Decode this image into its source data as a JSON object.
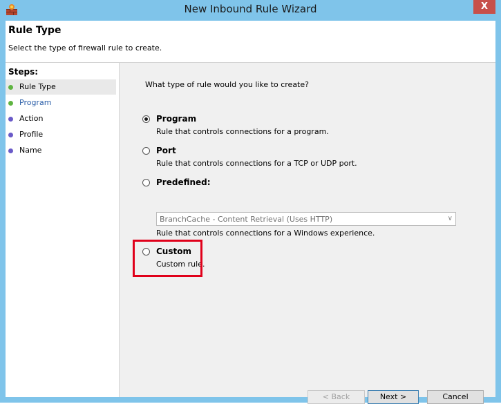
{
  "window": {
    "title": "New Inbound Rule Wizard",
    "close_glyph": "X"
  },
  "header": {
    "title": "Rule Type",
    "description": "Select the type of firewall rule to create."
  },
  "steps": {
    "title": "Steps:",
    "items": [
      {
        "label": "Rule Type",
        "color": "#5fb441"
      },
      {
        "label": "Program",
        "color": "#5fb441"
      },
      {
        "label": "Action",
        "color": "#6a5ac8"
      },
      {
        "label": "Profile",
        "color": "#6a5ac8"
      },
      {
        "label": "Name",
        "color": "#6a5ac8"
      }
    ]
  },
  "main": {
    "question": "What type of rule would you like to create?",
    "options": [
      {
        "label": "Program",
        "description": "Rule that controls connections for a program.",
        "selected": true
      },
      {
        "label": "Port",
        "description": "Rule that controls connections for a TCP or UDP port.",
        "selected": false
      },
      {
        "label": "Predefined:",
        "description": "",
        "selected": false
      },
      {
        "label": "Custom",
        "description": "Custom rule.",
        "selected": false
      }
    ],
    "predefined_dropdown": {
      "selected": "BranchCache - Content Retrieval (Uses HTTP)"
    },
    "predefined_description": "Rule that controls connections for a Windows experience."
  },
  "buttons": {
    "back": "< Back",
    "next": "Next >",
    "cancel": "Cancel"
  },
  "colors": {
    "highlight": "#e0001a",
    "link_blue": "#2a5ea8"
  }
}
